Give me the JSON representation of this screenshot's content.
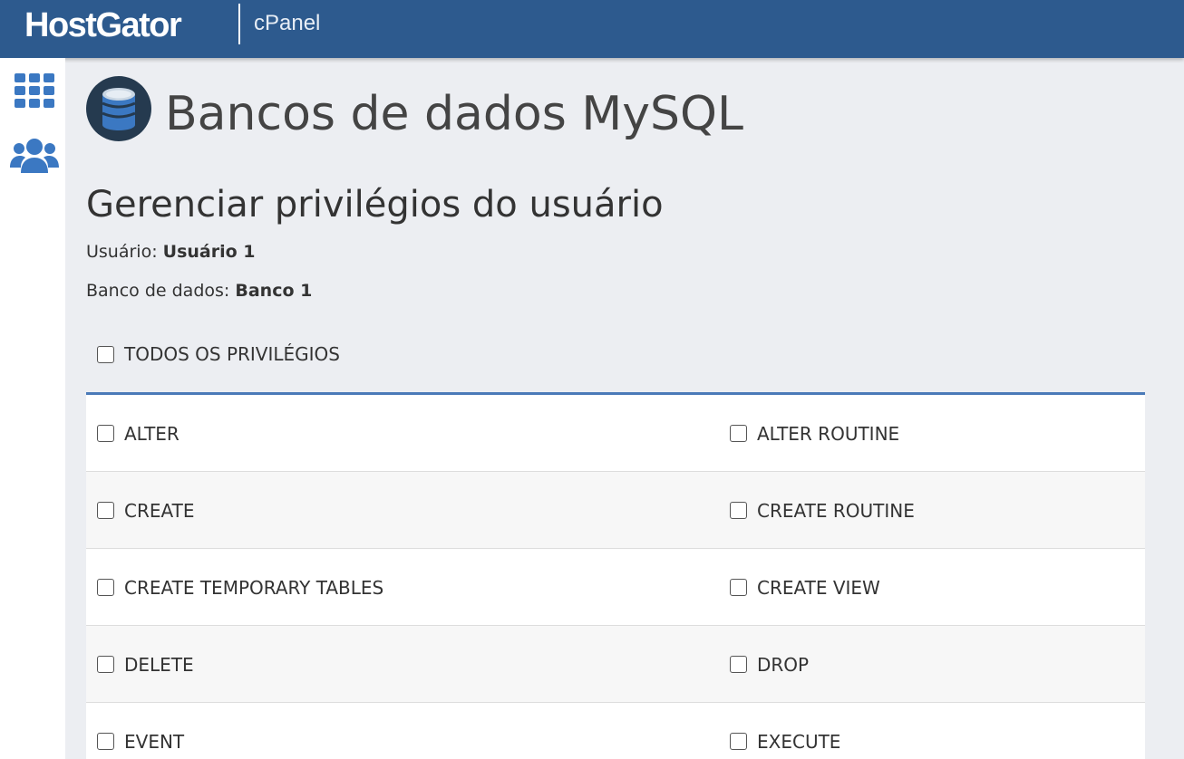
{
  "header": {
    "brand": "HostGator",
    "product": "cPanel"
  },
  "sidenav": {
    "items": [
      {
        "icon": "apps-grid-icon"
      },
      {
        "icon": "users-group-icon"
      }
    ]
  },
  "page": {
    "title": "Bancos de dados MySQL",
    "section_title": "Gerenciar privilégios do usuário",
    "user_label": "Usuário:",
    "user_value": "Usuário 1",
    "db_label": "Banco de dados:",
    "db_value": "Banco 1",
    "all_privileges_label": "TODOS OS PRIVILÉGIOS"
  },
  "privileges": {
    "rows": [
      {
        "left": "ALTER",
        "right": "ALTER ROUTINE"
      },
      {
        "left": "CREATE",
        "right": "CREATE ROUTINE"
      },
      {
        "left": "CREATE TEMPORARY TABLES",
        "right": "CREATE VIEW"
      },
      {
        "left": "DELETE",
        "right": "DROP"
      },
      {
        "left": "EVENT",
        "right": "EXECUTE"
      }
    ]
  },
  "colors": {
    "header_bg": "#2d5a8e",
    "accent": "#4a7ab8",
    "icon_blue": "#3b78c2"
  }
}
